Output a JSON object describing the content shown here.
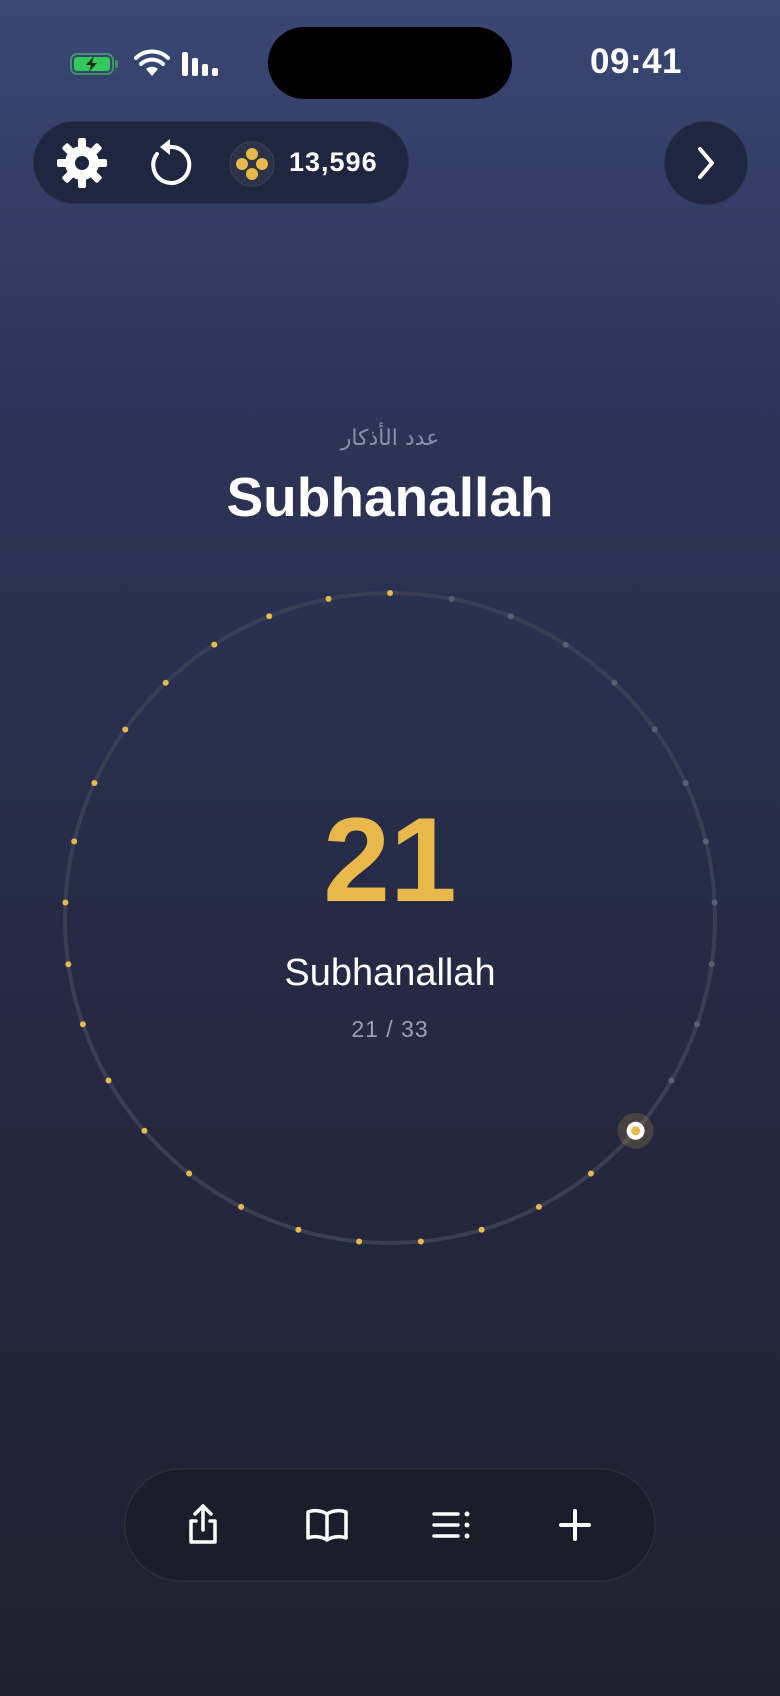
{
  "status_bar": {
    "time": "09:41",
    "battery_icon": "battery-charging-icon",
    "wifi_icon": "wifi-icon",
    "signal_icon": "cellular-signal-icon"
  },
  "toolbar": {
    "settings_icon": "gear-icon",
    "reset_icon": "reset-icon",
    "coin_icon": "coin-icon",
    "coins_value": "13,596"
  },
  "next_button": {
    "icon": "chevron-right-icon"
  },
  "header": {
    "subtitle": "عدد الأذكار",
    "title": "Subhanallah"
  },
  "counter": {
    "count": "21",
    "name": "Subhanallah",
    "progress_text": "21 / 33",
    "current": 21,
    "target": 33
  },
  "bottom_bar": {
    "items": [
      {
        "icon": "share-icon"
      },
      {
        "icon": "book-icon"
      },
      {
        "icon": "list-icon"
      },
      {
        "icon": "plus-icon"
      }
    ]
  },
  "colors": {
    "accent": "#e8b84a",
    "dot_inactive": "#5a5e72",
    "ring": "#3a3e55",
    "text_primary": "#ffffff",
    "text_muted": "#9a9fb4"
  }
}
